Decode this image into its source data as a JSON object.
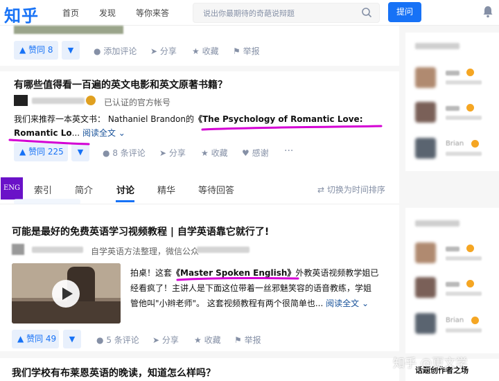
{
  "header": {
    "logo": "知乎",
    "nav": [
      "首页",
      "发现",
      "等你来答"
    ],
    "search_placeholder": "说出你最期待的奇葩说辩题",
    "ask_button": "提问"
  },
  "card_top": {
    "vote_label": "赞同 8",
    "actions": [
      "添加评论",
      "分享",
      "收藏",
      "举报"
    ]
  },
  "card2": {
    "title": "有哪些值得看一百遍的英文电影和英文原著书籍？",
    "author_badge": "已认证的官方帐号",
    "excerpt_prefix": "我们来推荐一本英文书： Nathaniel Brandon的",
    "excerpt_bold": "《The Psychology of Romantic Love: Romantic Lo",
    "excerpt_ellipsis": "...",
    "read_more": "阅读全文",
    "vote_label": "赞同 225",
    "actions": [
      "8 条评论",
      "分享",
      "收藏",
      "感谢"
    ]
  },
  "tabs": {
    "badge": "ENG",
    "items": [
      "索引",
      "简介",
      "讨论",
      "精华",
      "等待回答"
    ],
    "active": "讨论",
    "sort_label": "切换为时间排序"
  },
  "card3": {
    "title": "可能是最好的免费英语学习视频教程 | 自学英语靠它就行了!",
    "author_desc": "自学英语方法整理，微信公众",
    "excerpt_l1_prefix": "拍桌！这套",
    "excerpt_l1_bold": "《Master Spoken English》",
    "excerpt_l1_suffix": "外教英语视频教学姐已",
    "excerpt_l2": "经看疯了！主讲人是下面这位带着一丝邪魅笑容的语音教练，学姐",
    "excerpt_l3": "管他叫\"小辫老师\"。 这套视频教程有两个很简单也...",
    "read_more": "阅读全文",
    "vote_label": "赞同 49",
    "actions": [
      "5 条评论",
      "分享",
      "收藏",
      "举报"
    ]
  },
  "card4": {
    "title": "我们学校有布莱恩英语的晚读，知道怎么样吗？"
  },
  "sidebar": {
    "users": [
      "Brian"
    ],
    "bottom_label": "话题创作者之场"
  },
  "watermark": "知乎 @更文学",
  "colors": {
    "accent": "#1772f6",
    "highlight": "#d400d4"
  }
}
